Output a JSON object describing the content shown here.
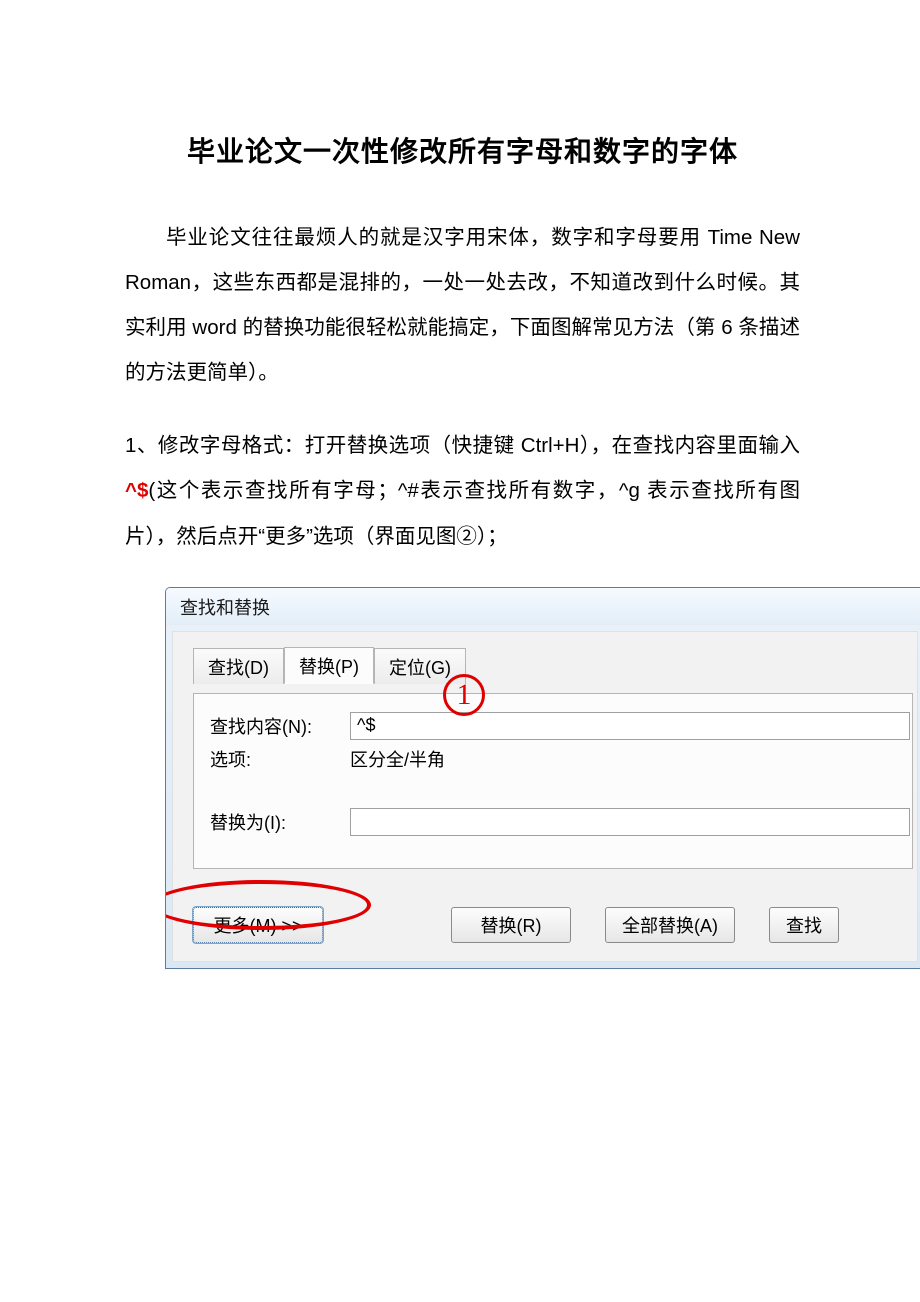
{
  "doc": {
    "title": "毕业论文一次性修改所有字母和数字的字体",
    "para1_prefix": "毕业论文往往最烦人的就是汉字用宋体，数字和字母要用 Time New Roman，这些东西都是混排的，一处一处去改，不知道改到什么时候。其实利用 word 的替换功能很轻松就能搞定，下面图解常见方法（第 6 条描述的方法更简单）。",
    "para2_pre": "1、修改字母格式：打开替换选项（快捷键 Ctrl+H），在查找内容里面输入",
    "para2_red": "^$",
    "para2_post": "(这个表示查找所有字母；^#表示查找所有数字，^g 表示查找所有图片），然后点开“更多”选项（界面见图②）；"
  },
  "dialog": {
    "title": "查找和替换",
    "tabs": {
      "find": "查找(D)",
      "replace": "替换(P)",
      "goto": "定位(G)"
    },
    "labels": {
      "find_what": "查找内容(N):",
      "options": "选项:",
      "options_val": "区分全/半角",
      "replace_with": "替换为(I):"
    },
    "find_value": "^$",
    "buttons": {
      "more": "更多(M) >>",
      "replace": "替换(R)",
      "replace_all": "全部替换(A)",
      "find_next": "查找"
    },
    "marker": "1"
  }
}
